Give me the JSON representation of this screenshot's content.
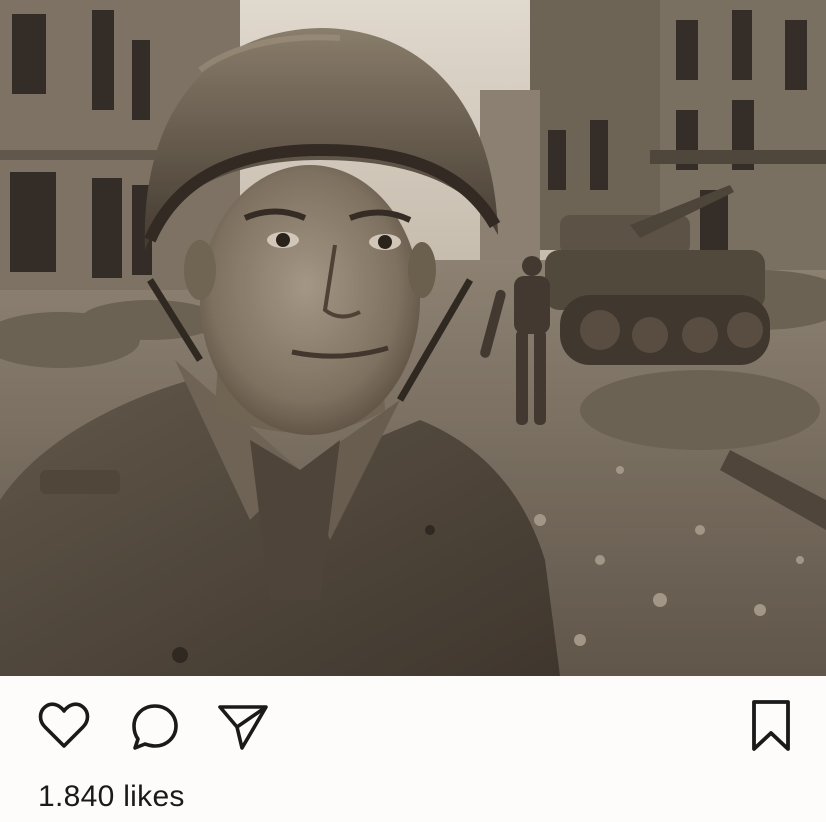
{
  "post": {
    "photo": {
      "subject": "soldier-selfie-in-ruined-city",
      "tone": "sepia"
    },
    "actions": {
      "like_icon": "heart-icon",
      "comment_icon": "comment-bubble-icon",
      "share_icon": "paper-plane-icon",
      "save_icon": "bookmark-icon"
    },
    "likes_text": "1.840 likes"
  },
  "colors": {
    "background": "#fdfcfa",
    "icon_stroke": "#1a1a1a",
    "text": "#1a1a1a"
  }
}
